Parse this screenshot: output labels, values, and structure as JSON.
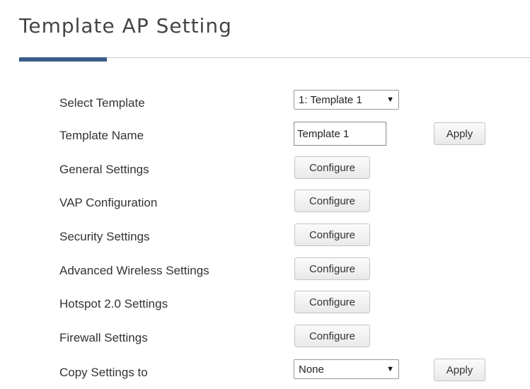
{
  "header": {
    "title": "Template AP Setting"
  },
  "colors": {
    "accent": "#3b5c8a",
    "rule": "#c8c8c8"
  },
  "form": {
    "select_template": {
      "label": "Select Template",
      "value": "1: Template 1"
    },
    "template_name": {
      "label": "Template Name",
      "value": "Template 1",
      "apply_label": "Apply"
    },
    "general_settings": {
      "label": "General Settings",
      "button_label": "Configure"
    },
    "vap_configuration": {
      "label": "VAP Configuration",
      "button_label": "Configure"
    },
    "security_settings": {
      "label": "Security Settings",
      "button_label": "Configure"
    },
    "advanced_wireless_settings": {
      "label": "Advanced Wireless Settings",
      "button_label": "Configure"
    },
    "hotspot_settings": {
      "label": "Hotspot 2.0 Settings",
      "button_label": "Configure"
    },
    "firewall_settings": {
      "label": "Firewall Settings",
      "button_label": "Configure"
    },
    "copy_settings": {
      "label": "Copy Settings to",
      "value": "None",
      "apply_label": "Apply"
    }
  },
  "icons": {
    "dropdown": "chevron-down-icon"
  }
}
